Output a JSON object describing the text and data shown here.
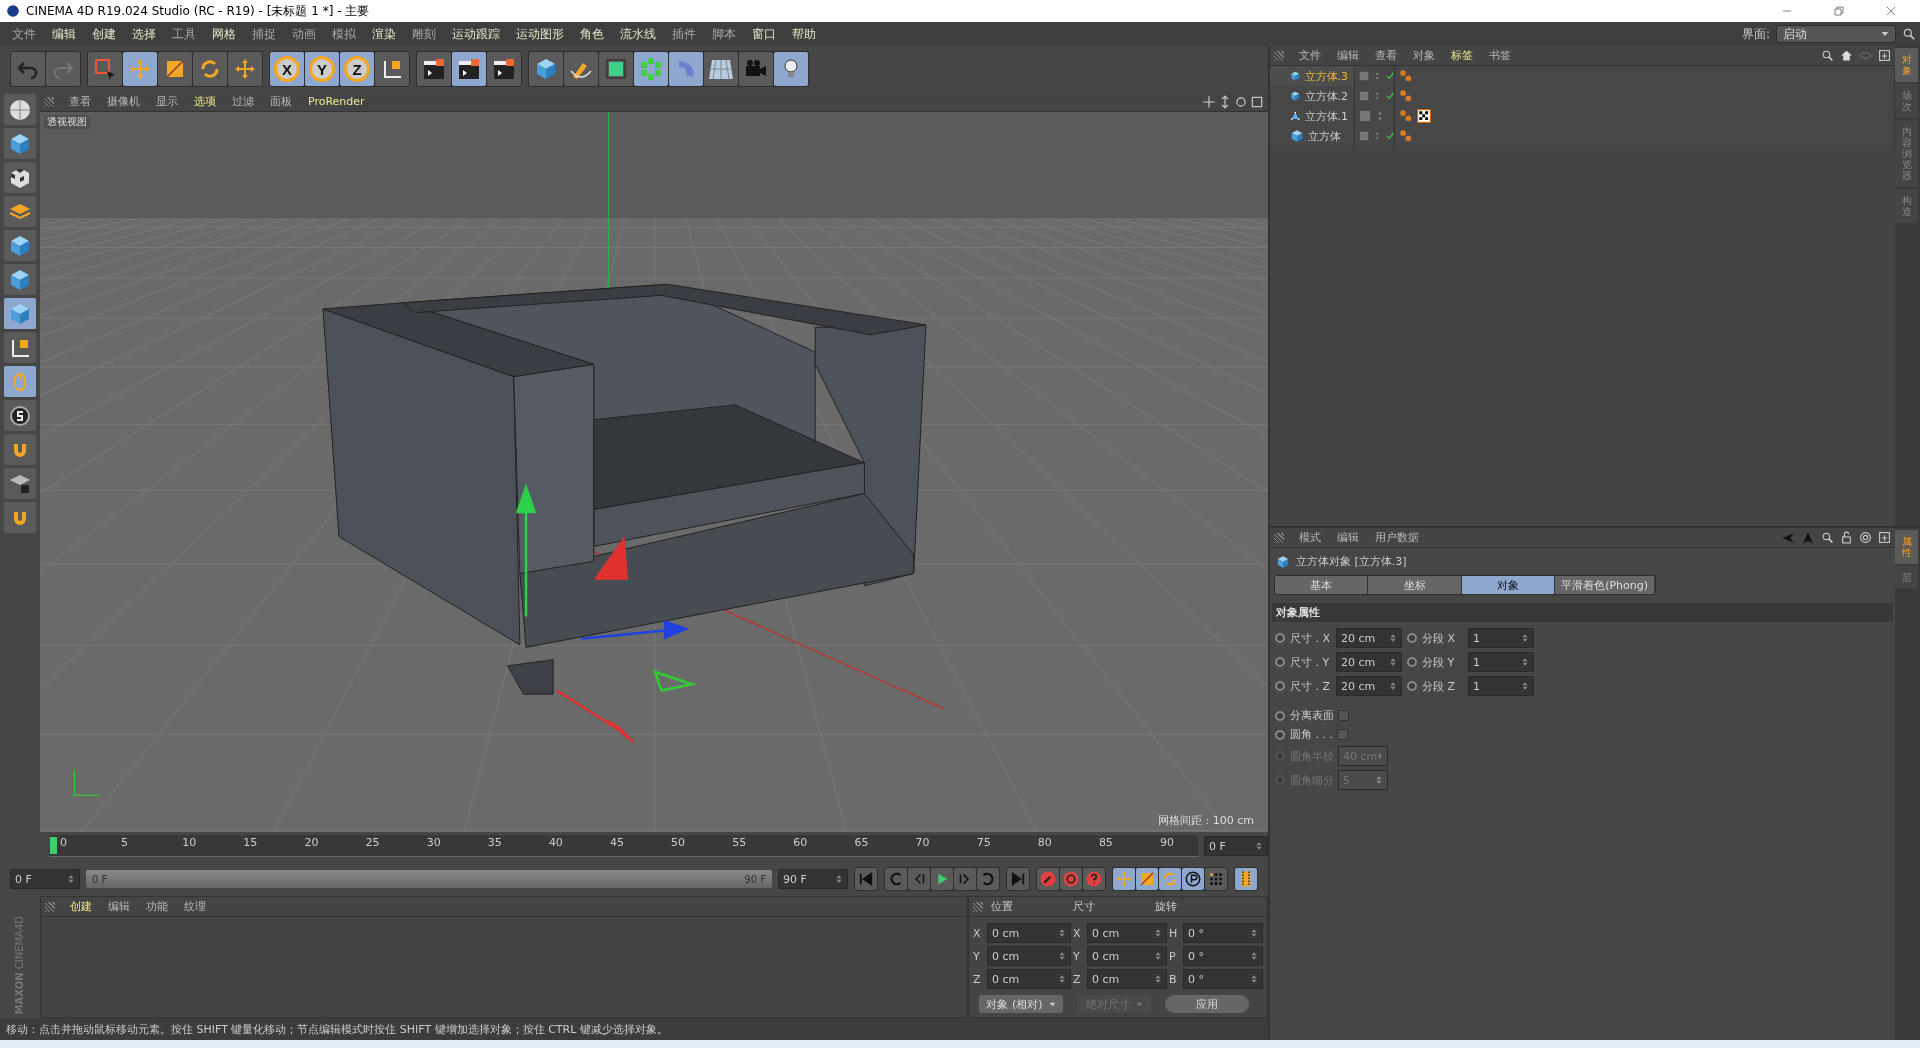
{
  "window": {
    "title": "CINEMA 4D R19.024 Studio (RC - R19) - [未标题 1 *] - 主要"
  },
  "menu": [
    {
      "label": "文件",
      "bright": false
    },
    {
      "label": "编辑",
      "bright": true
    },
    {
      "label": "创建",
      "bright": true
    },
    {
      "label": "选择",
      "bright": true
    },
    {
      "label": "工具",
      "bright": false
    },
    {
      "label": "网格",
      "bright": true
    },
    {
      "label": "捕捉",
      "bright": false
    },
    {
      "label": "动画",
      "bright": false
    },
    {
      "label": "模拟",
      "bright": false
    },
    {
      "label": "渲染",
      "bright": true
    },
    {
      "label": "雕刻",
      "bright": false
    },
    {
      "label": "运动跟踪",
      "bright": true
    },
    {
      "label": "运动图形",
      "bright": true
    },
    {
      "label": "角色",
      "bright": true
    },
    {
      "label": "流水线",
      "bright": true
    },
    {
      "label": "插件",
      "bright": false
    },
    {
      "label": "脚本",
      "bright": false
    },
    {
      "label": "窗口",
      "bright": true
    },
    {
      "label": "帮助",
      "bright": true
    }
  ],
  "layout": {
    "label": "界面:",
    "value": "启动"
  },
  "main_toolbar": [
    [
      {
        "active": false
      },
      {
        "active": false
      }
    ],
    [
      {
        "active": false
      },
      {
        "active": true
      },
      {
        "active": false
      },
      {
        "active": false
      },
      {
        "active": false
      }
    ],
    [
      {
        "label": "X",
        "active": true
      },
      {
        "label": "Y",
        "active": true
      },
      {
        "label": "Z",
        "active": true
      },
      {
        "active": false
      }
    ],
    [
      {
        "active": false
      },
      {
        "active": true
      },
      {
        "active": false
      }
    ],
    [
      {
        "active": false
      },
      {
        "active": false
      },
      {
        "active": false
      },
      {
        "active": true
      },
      {
        "active": true
      },
      {
        "active": false
      },
      {
        "active": false
      },
      {
        "active": true
      }
    ]
  ],
  "left_toolbar": [
    {
      "active": false
    },
    {
      "active": false
    },
    {
      "active": false
    },
    {
      "active": false
    },
    {
      "active": false
    },
    {
      "active": false
    },
    {
      "active": true
    },
    {
      "active": false
    },
    {
      "active": true
    },
    {
      "active": false
    },
    {
      "active": false
    },
    {
      "active": false
    },
    {
      "active": false
    }
  ],
  "viewport": {
    "menu": [
      {
        "label": "查看",
        "selected": false
      },
      {
        "label": "摄像机",
        "selected": false
      },
      {
        "label": "显示",
        "selected": false
      },
      {
        "label": "选项",
        "selected": true
      },
      {
        "label": "过滤",
        "selected": false
      },
      {
        "label": "面板",
        "selected": false
      },
      {
        "label": "ProRender",
        "selected": true
      }
    ],
    "camera": "透视视图",
    "grid_spacing": "网格间距 : 100 cm"
  },
  "timeline": {
    "ticks": [
      "0",
      "5",
      "10",
      "15",
      "20",
      "25",
      "30",
      "35",
      "40",
      "45",
      "50",
      "55",
      "60",
      "65",
      "70",
      "75",
      "80",
      "85",
      "90"
    ],
    "current": "0 F",
    "start": "0 F",
    "range": {
      "start": "0 F",
      "end": "90 F",
      "level": 1
    },
    "end": "90 F"
  },
  "transport": [
    [
      {
        "active": false
      }
    ],
    [
      {
        "active": false
      },
      {
        "active": false
      },
      {
        "active": false
      },
      {
        "active": false
      },
      {
        "active": false
      }
    ],
    [
      {
        "active": false
      }
    ],
    [
      {
        "active": false
      },
      {
        "active": false
      },
      {
        "active": false
      }
    ],
    [
      {
        "active": true
      },
      {
        "active": true
      },
      {
        "active": true
      },
      {
        "active": true
      },
      {
        "active": false
      }
    ],
    [
      {
        "active": true
      }
    ]
  ],
  "materials": {
    "menu": [
      {
        "label": "创建",
        "selected": true
      },
      {
        "label": "编辑",
        "selected": false
      },
      {
        "label": "功能",
        "selected": false
      },
      {
        "label": "纹理",
        "selected": false
      }
    ],
    "logo": [
      "MAXON",
      "CINEMA4D"
    ]
  },
  "coordinates": {
    "headers": [
      "位置",
      "尺寸",
      "旋转"
    ],
    "rows": [
      [
        "X",
        "0 cm",
        "X",
        "0 cm",
        "H",
        "0 °"
      ],
      [
        "Y",
        "0 cm",
        "Y",
        "0 cm",
        "P",
        "0 °"
      ],
      [
        "Z",
        "0 cm",
        "Z",
        "0 cm",
        "B",
        "0 °"
      ]
    ],
    "mode": "对象 (相对)",
    "size_mode": "绝对尺寸",
    "apply": "应用"
  },
  "objects": {
    "menu": [
      {
        "label": "文件",
        "selected": false
      },
      {
        "label": "编辑",
        "selected": false
      },
      {
        "label": "查看",
        "selected": false
      },
      {
        "label": "对象",
        "selected": false
      },
      {
        "label": "标签",
        "selected": true
      },
      {
        "label": "书签",
        "selected": false
      }
    ],
    "items": [
      {
        "name": "立方体.3",
        "kind": "cube",
        "selected": true,
        "enabled": true,
        "texture": false
      },
      {
        "name": "立方体.2",
        "kind": "cube",
        "selected": false,
        "enabled": true,
        "texture": false
      },
      {
        "name": "立方体.1",
        "kind": "polygon",
        "selected": false,
        "enabled": false,
        "texture": true
      },
      {
        "name": "立方体",
        "kind": "cube",
        "selected": false,
        "enabled": true,
        "texture": false
      }
    ]
  },
  "side_tabs_top": [
    {
      "label": "对象",
      "selected": true
    },
    {
      "label": "场次",
      "selected": false
    },
    {
      "label": "内容浏览器",
      "selected": false
    },
    {
      "label": "构造",
      "selected": false
    }
  ],
  "side_tabs_bottom": [
    {
      "label": "属性",
      "selected": true
    },
    {
      "label": "层",
      "selected": false
    }
  ],
  "attributes": {
    "menu": [
      "模式",
      "编辑",
      "用户数据"
    ],
    "title": "立方体对象 [立方体.3]",
    "tabs": [
      {
        "label": "基本",
        "selected": false
      },
      {
        "label": "坐标",
        "selected": false
      },
      {
        "label": "对象",
        "selected": true
      },
      {
        "label": "平滑着色(Phong)",
        "selected": false
      }
    ],
    "section": "对象属性",
    "pairs": [
      [
        {
          "label": "尺寸 . X",
          "value": "20 cm"
        },
        {
          "label": "分段 X",
          "value": "1"
        }
      ],
      [
        {
          "label": "尺寸 . Y",
          "value": "20 cm"
        },
        {
          "label": "分段 Y",
          "value": "1"
        }
      ],
      [
        {
          "label": "尺寸 . Z",
          "value": "20 cm"
        },
        {
          "label": "分段 Z",
          "value": "1"
        }
      ]
    ],
    "options": [
      {
        "kind": "checkbox",
        "label": "分离表面",
        "checked": false,
        "disabled": false
      },
      {
        "kind": "checkbox",
        "label": "圆角 . . .",
        "checked": false,
        "disabled": false
      },
      {
        "kind": "field",
        "label": "圆角半径",
        "value": "40 cm",
        "disabled": true
      },
      {
        "kind": "field",
        "label": "圆角细分",
        "value": "5",
        "disabled": true
      }
    ]
  },
  "status_bar": "移动：点击并拖动鼠标移动元素。按住 SHIFT 键量化移动；节点编辑模式时按住 SHIFT 键增加选择对象；按住 CTRL 键减少选择对象。"
}
